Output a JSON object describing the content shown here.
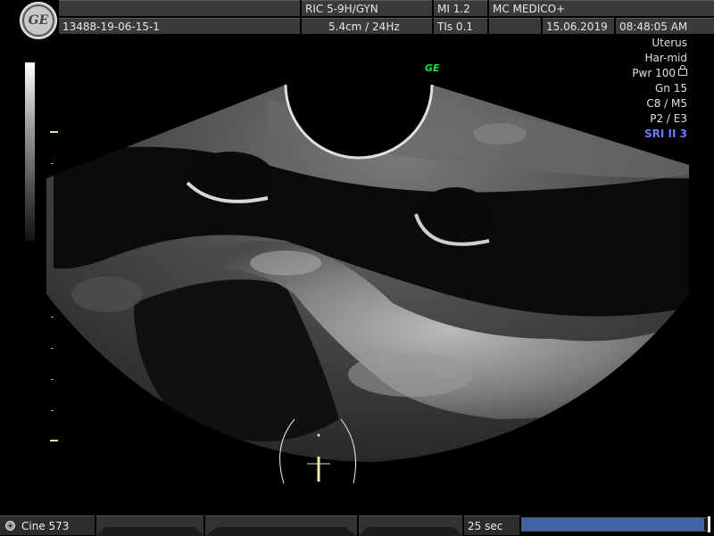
{
  "header": {
    "logo": "GE",
    "probe_preset": "RIC 5-9H/GYN",
    "mi": "MI  1.2",
    "institution": "MC MEDICO+",
    "patient_id": "13488-19-06-15-1",
    "depth_freq": "5.4cm / 24Hz",
    "tis": "TIs  0.1",
    "date": "15.06.2019",
    "time": "08:48:05 AM"
  },
  "params": {
    "organ": "Uterus",
    "harmonic": "Har-mid",
    "power": "Pwr 100",
    "gain": "Gn  15",
    "cm": "C8 / M5",
    "pe": "P2 / E3",
    "sri": "SRI II 3"
  },
  "orientation_mark": "GE",
  "footer": {
    "cine": "Cine 573",
    "duration": "25 sec",
    "progress": 0.97
  },
  "icons": {
    "logo": "ge-logo-icon",
    "lock": "lock-icon",
    "cine": "cine-reel-icon"
  }
}
